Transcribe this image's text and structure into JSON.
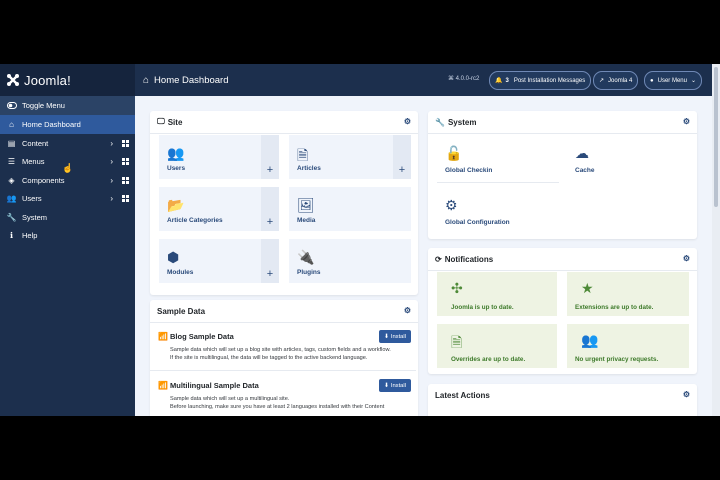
{
  "brand": {
    "name": "Joomla!"
  },
  "header": {
    "title": "Home Dashboard",
    "version": "⌘ 4.0.0-rc2",
    "messages_count": "3",
    "messages_label": "Post Installation Messages",
    "joomla4_label": "Joomla 4",
    "user_menu_label": "User Menu"
  },
  "sidebar": {
    "toggle_label": "Toggle Menu",
    "items": [
      {
        "label": "Home Dashboard"
      },
      {
        "label": "Content"
      },
      {
        "label": "Menus"
      },
      {
        "label": "Components"
      },
      {
        "label": "Users"
      },
      {
        "label": "System"
      },
      {
        "label": "Help"
      }
    ]
  },
  "site": {
    "title": "Site",
    "tiles": [
      {
        "label": "Users"
      },
      {
        "label": "Articles"
      },
      {
        "label": "Article Categories"
      },
      {
        "label": "Media"
      },
      {
        "label": "Modules"
      },
      {
        "label": "Plugins"
      }
    ]
  },
  "system": {
    "title": "System",
    "tiles": [
      {
        "label": "Global Checkin"
      },
      {
        "label": "Cache"
      },
      {
        "label": "Global Configuration"
      }
    ]
  },
  "notifications": {
    "title": "Notifications",
    "items": [
      {
        "label": "Joomla is up to date."
      },
      {
        "label": "Extensions are up to date."
      },
      {
        "label": "Overrides are up to date."
      },
      {
        "label": "No urgent privacy requests."
      }
    ]
  },
  "sample_data": {
    "title": "Sample Data",
    "install_label": "Install",
    "items": [
      {
        "title": "Blog Sample Data",
        "desc1": "Sample data which will set up a blog site with articles, tags, custom fields and a workflow.",
        "desc2": "If the site is multilingual, the data will be tagged to the active backend language."
      },
      {
        "title": "Multilingual Sample Data",
        "desc1": "Sample data which will set up a multilingual site.",
        "desc2": "Before launching, make sure you have at least 2 languages installed with their Content"
      }
    ]
  },
  "latest_actions": {
    "title": "Latest Actions"
  },
  "colors": {
    "sidebar": "#1c2f4d",
    "accent": "#2f5a9d",
    "success": "#3d7a2a"
  }
}
